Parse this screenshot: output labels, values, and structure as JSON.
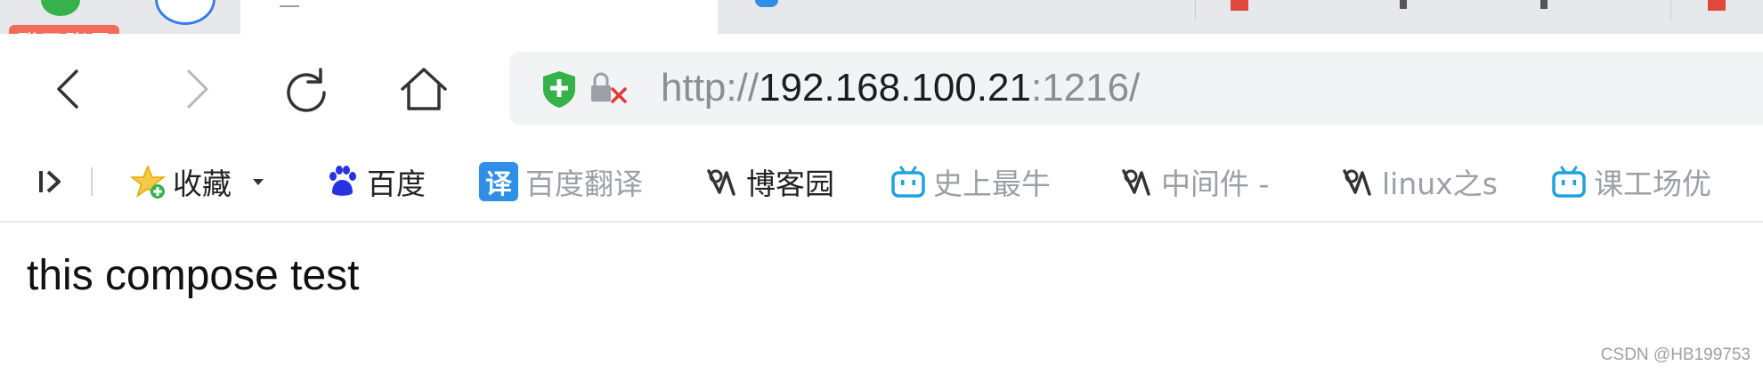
{
  "tabs": {
    "login_badge": "登录账号"
  },
  "navigation": {
    "back_icon": "chevron-left-icon",
    "forward_icon": "chevron-right-icon",
    "reload_icon": "reload-icon",
    "home_icon": "home-icon"
  },
  "address_bar": {
    "url_protocol": "http://",
    "url_host": "192.168.100.21",
    "url_port": ":1216/",
    "security_icons": [
      "shield-plus-icon",
      "lock-x-icon"
    ]
  },
  "bookmarks": {
    "items": [
      {
        "label": "收藏",
        "icon": "star-icon"
      },
      {
        "label": "百度",
        "icon": "baidu-paw-icon"
      },
      {
        "label": "百度翻译",
        "icon": "translate-icon",
        "badge": "译"
      },
      {
        "label": "博客园",
        "icon": "cnblogs-icon"
      },
      {
        "label": "史上最牛",
        "icon": "bilibili-tv-icon"
      },
      {
        "label": "中间件 -",
        "icon": "cnblogs-icon"
      },
      {
        "label": "linux之s",
        "icon": "cnblogs-icon"
      },
      {
        "label": "课工场优",
        "icon": "bilibili-tv-icon"
      }
    ]
  },
  "page": {
    "content_text": "this compose test"
  },
  "watermark": "CSDN @HB199753",
  "colors": {
    "badge": "#f26b5b",
    "shield": "#35b34a",
    "address_bar_bg": "#f1f3f4",
    "bookmark_blue": "#2f8fe6"
  }
}
